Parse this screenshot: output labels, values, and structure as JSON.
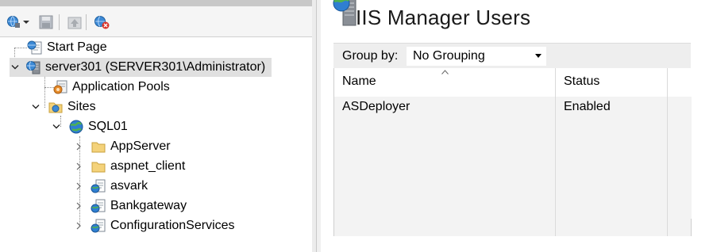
{
  "toolbar": {
    "items": [
      {
        "name": "connect-icon"
      },
      {
        "name": "save-icon"
      },
      {
        "name": "up-icon"
      },
      {
        "name": "disconnect-icon"
      }
    ]
  },
  "tree": {
    "start_page": "Start Page",
    "server": "server301 (SERVER301\\Administrator)",
    "app_pools": "Application Pools",
    "sites": "Sites",
    "site": "SQL01",
    "children": [
      {
        "label": "AppServer",
        "icon": "folder-icon"
      },
      {
        "label": "aspnet_client",
        "icon": "folder-icon"
      },
      {
        "label": "asvark",
        "icon": "application-icon"
      },
      {
        "label": "Bankgateway",
        "icon": "application-icon"
      },
      {
        "label": "ConfigurationServices",
        "icon": "application-icon"
      }
    ]
  },
  "page": {
    "title": "IIS Manager Users",
    "group_by_label": "Group by:",
    "group_by_value": "No Grouping"
  },
  "table": {
    "columns": [
      "Name",
      "Status"
    ],
    "rows": [
      {
        "name": "ASDeployer",
        "status": "Enabled"
      }
    ]
  },
  "colors": {
    "selection": "#e0e0e0",
    "globe": "#2f7fd1",
    "folder": "#f4d27a",
    "server_gray": "#8a8f96"
  }
}
